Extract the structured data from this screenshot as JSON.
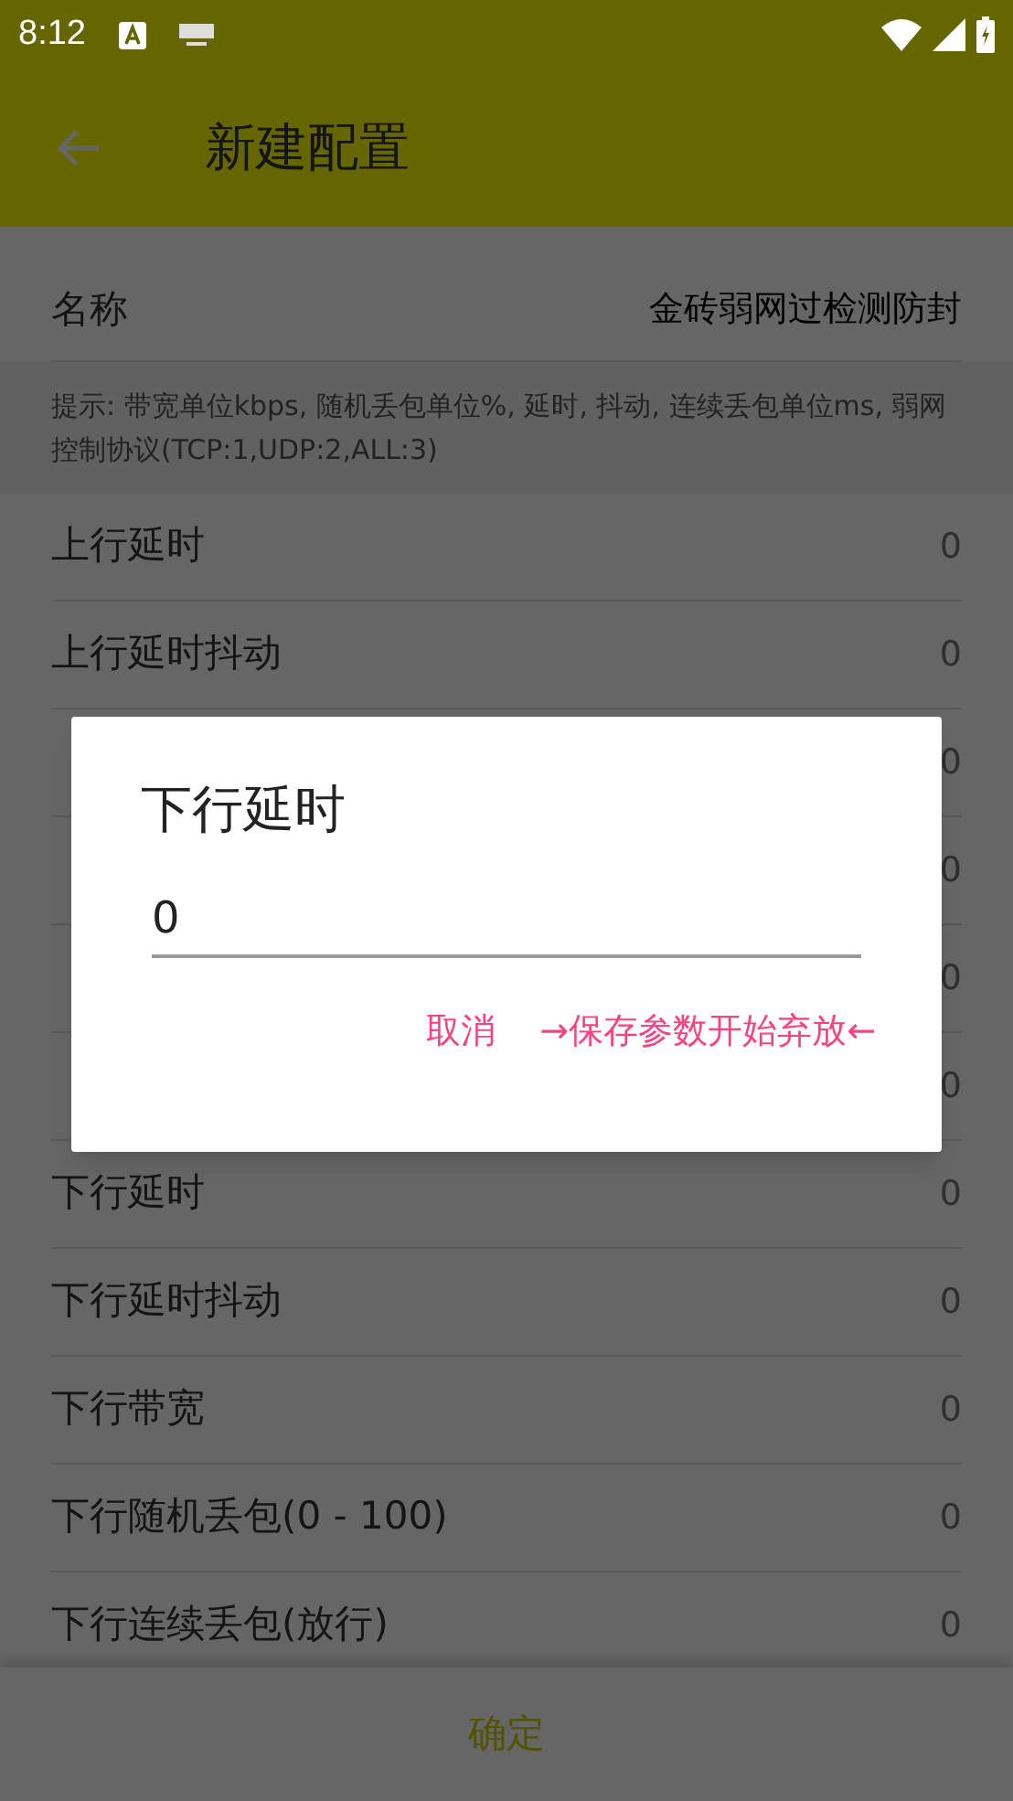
{
  "status_bar": {
    "time": "8:12"
  },
  "app_bar": {
    "title": "新建配置"
  },
  "name_field": {
    "label": "名称",
    "value": "金砖弱网过检测防封"
  },
  "hint": "提示: 带宽单位kbps, 随机丢包单位%, 延时, 抖动, 连续丢包单位ms, 弱网控制协议(TCP:1,UDP:2,ALL:3)",
  "rows": [
    {
      "label": "上行延时",
      "value": "0"
    },
    {
      "label": "上行延时抖动",
      "value": "0"
    },
    {
      "value": "0"
    },
    {
      "value": "0"
    },
    {
      "value": "0"
    },
    {
      "value": "0"
    },
    {
      "label": "下行延时",
      "value": "0"
    },
    {
      "label": "下行延时抖动",
      "value": "0"
    },
    {
      "label": "下行带宽",
      "value": "0"
    },
    {
      "label": "下行随机丢包(0 - 100)",
      "value": "0"
    },
    {
      "label": "下行连续丢包(放行)",
      "value": "0"
    }
  ],
  "confirm_button": "确定",
  "dialog": {
    "title": "下行延时",
    "value": "0",
    "buttons": [
      "取消",
      "→保存参数开始弃放←"
    ]
  }
}
